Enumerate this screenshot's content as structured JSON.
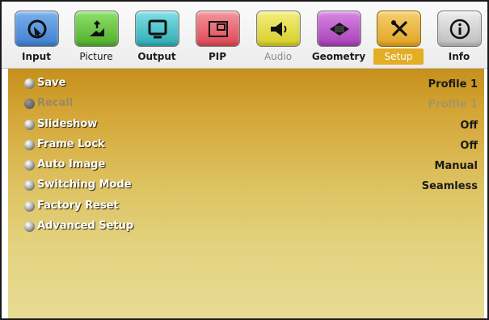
{
  "tabs": [
    {
      "label": "Input",
      "icon": "input-icon",
      "color": "#4f8fd8",
      "state": "normal-bold"
    },
    {
      "label": "Picture",
      "icon": "picture-icon",
      "color": "#61c23a",
      "state": "normal"
    },
    {
      "label": "Output",
      "icon": "output-icon",
      "color": "#41bcc4",
      "state": "normal-bold"
    },
    {
      "label": "PIP",
      "icon": "pip-icon",
      "color": "#e9606a",
      "state": "normal-bold"
    },
    {
      "label": "Audio",
      "icon": "audio-icon",
      "color": "#e4dc3a",
      "state": "disabled"
    },
    {
      "label": "Geometry",
      "icon": "geometry-icon",
      "color": "#b857c6",
      "state": "normal-bold"
    },
    {
      "label": "Setup",
      "icon": "setup-icon",
      "color": "#e7b032",
      "state": "active"
    },
    {
      "label": "Info",
      "icon": "info-icon",
      "color": "#cfcfcf",
      "state": "normal-bold"
    }
  ],
  "menu": {
    "items": [
      {
        "label": "Save",
        "value": "Profile 1",
        "enabled": true
      },
      {
        "label": "Recall",
        "value": "Profile 1",
        "enabled": false
      },
      {
        "label": "Slideshow",
        "value": "Off",
        "enabled": true
      },
      {
        "label": "Frame Lock",
        "value": "Off",
        "enabled": true
      },
      {
        "label": "Auto Image",
        "value": "Manual",
        "enabled": true
      },
      {
        "label": "Switching Mode",
        "value": "Seamless",
        "enabled": true
      },
      {
        "label": "Factory Reset",
        "value": "",
        "enabled": true
      },
      {
        "label": "Advanced Setup",
        "value": "",
        "enabled": true
      }
    ]
  }
}
